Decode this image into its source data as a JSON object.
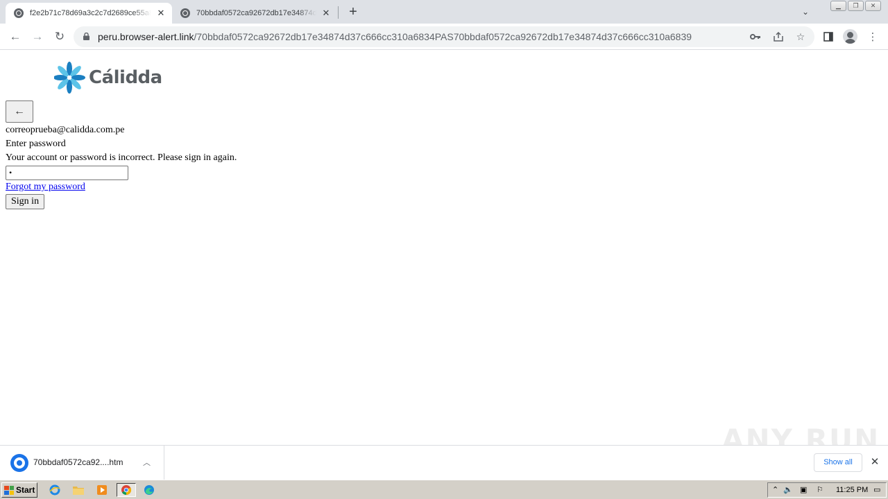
{
  "browser": {
    "tabs": [
      {
        "title": "f2e2b71c78d69a3c2c7d2689ce55a8",
        "active": true
      },
      {
        "title": "70bbdaf0572ca92672db17e34874d37c",
        "active": false
      }
    ],
    "new_tab_icon": "plus-icon",
    "url": {
      "host": "peru.browser-alert.link",
      "path": "/70bbdaf0572ca92672db17e34874d37c666cc310a6834PAS70bbdaf0572ca92672db17e34874d37c666cc310a6839"
    }
  },
  "page": {
    "logo_text": "Cálidda",
    "back_icon": "arrow-left-icon",
    "email": "correoprueba@calidda.com.pe",
    "heading": "Enter password",
    "error": "Your account or password is incorrect. Please sign in again.",
    "password_value": "•",
    "forgot_link": "Forgot my password",
    "signin_label": "Sign in",
    "brand_colors": {
      "petal_light": "#5cc3e8",
      "petal_dark": "#1b7fc1",
      "wordmark": "#5a5f63"
    }
  },
  "watermark": "ANY RUN",
  "downloads": {
    "file_name": "70bbdaf0572ca92....htm",
    "show_all_label": "Show all"
  },
  "taskbar": {
    "start_label": "Start",
    "clock": "11:25 PM"
  }
}
